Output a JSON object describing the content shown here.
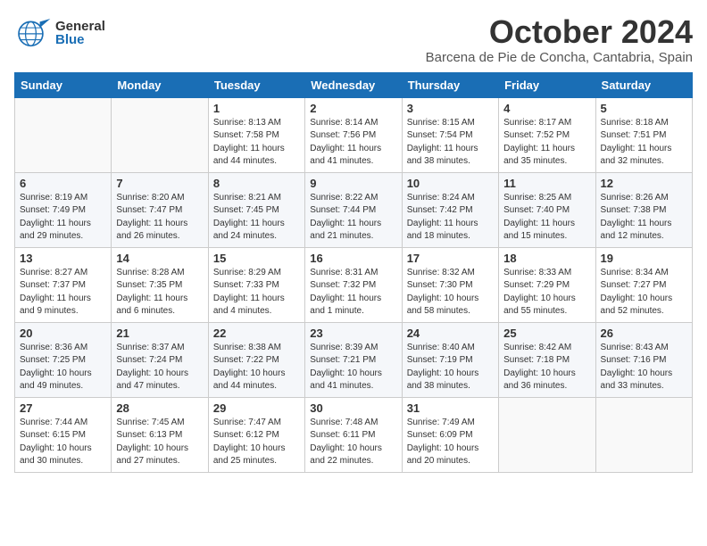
{
  "header": {
    "logo_general": "General",
    "logo_blue": "Blue",
    "month_title": "October 2024",
    "location": "Barcena de Pie de Concha, Cantabria, Spain"
  },
  "days_of_week": [
    "Sunday",
    "Monday",
    "Tuesday",
    "Wednesday",
    "Thursday",
    "Friday",
    "Saturday"
  ],
  "weeks": [
    [
      {
        "day": "",
        "info": ""
      },
      {
        "day": "",
        "info": ""
      },
      {
        "day": "1",
        "info": "Sunrise: 8:13 AM\nSunset: 7:58 PM\nDaylight: 11 hours and 44 minutes."
      },
      {
        "day": "2",
        "info": "Sunrise: 8:14 AM\nSunset: 7:56 PM\nDaylight: 11 hours and 41 minutes."
      },
      {
        "day": "3",
        "info": "Sunrise: 8:15 AM\nSunset: 7:54 PM\nDaylight: 11 hours and 38 minutes."
      },
      {
        "day": "4",
        "info": "Sunrise: 8:17 AM\nSunset: 7:52 PM\nDaylight: 11 hours and 35 minutes."
      },
      {
        "day": "5",
        "info": "Sunrise: 8:18 AM\nSunset: 7:51 PM\nDaylight: 11 hours and 32 minutes."
      }
    ],
    [
      {
        "day": "6",
        "info": "Sunrise: 8:19 AM\nSunset: 7:49 PM\nDaylight: 11 hours and 29 minutes."
      },
      {
        "day": "7",
        "info": "Sunrise: 8:20 AM\nSunset: 7:47 PM\nDaylight: 11 hours and 26 minutes."
      },
      {
        "day": "8",
        "info": "Sunrise: 8:21 AM\nSunset: 7:45 PM\nDaylight: 11 hours and 24 minutes."
      },
      {
        "day": "9",
        "info": "Sunrise: 8:22 AM\nSunset: 7:44 PM\nDaylight: 11 hours and 21 minutes."
      },
      {
        "day": "10",
        "info": "Sunrise: 8:24 AM\nSunset: 7:42 PM\nDaylight: 11 hours and 18 minutes."
      },
      {
        "day": "11",
        "info": "Sunrise: 8:25 AM\nSunset: 7:40 PM\nDaylight: 11 hours and 15 minutes."
      },
      {
        "day": "12",
        "info": "Sunrise: 8:26 AM\nSunset: 7:38 PM\nDaylight: 11 hours and 12 minutes."
      }
    ],
    [
      {
        "day": "13",
        "info": "Sunrise: 8:27 AM\nSunset: 7:37 PM\nDaylight: 11 hours and 9 minutes."
      },
      {
        "day": "14",
        "info": "Sunrise: 8:28 AM\nSunset: 7:35 PM\nDaylight: 11 hours and 6 minutes."
      },
      {
        "day": "15",
        "info": "Sunrise: 8:29 AM\nSunset: 7:33 PM\nDaylight: 11 hours and 4 minutes."
      },
      {
        "day": "16",
        "info": "Sunrise: 8:31 AM\nSunset: 7:32 PM\nDaylight: 11 hours and 1 minute."
      },
      {
        "day": "17",
        "info": "Sunrise: 8:32 AM\nSunset: 7:30 PM\nDaylight: 10 hours and 58 minutes."
      },
      {
        "day": "18",
        "info": "Sunrise: 8:33 AM\nSunset: 7:29 PM\nDaylight: 10 hours and 55 minutes."
      },
      {
        "day": "19",
        "info": "Sunrise: 8:34 AM\nSunset: 7:27 PM\nDaylight: 10 hours and 52 minutes."
      }
    ],
    [
      {
        "day": "20",
        "info": "Sunrise: 8:36 AM\nSunset: 7:25 PM\nDaylight: 10 hours and 49 minutes."
      },
      {
        "day": "21",
        "info": "Sunrise: 8:37 AM\nSunset: 7:24 PM\nDaylight: 10 hours and 47 minutes."
      },
      {
        "day": "22",
        "info": "Sunrise: 8:38 AM\nSunset: 7:22 PM\nDaylight: 10 hours and 44 minutes."
      },
      {
        "day": "23",
        "info": "Sunrise: 8:39 AM\nSunset: 7:21 PM\nDaylight: 10 hours and 41 minutes."
      },
      {
        "day": "24",
        "info": "Sunrise: 8:40 AM\nSunset: 7:19 PM\nDaylight: 10 hours and 38 minutes."
      },
      {
        "day": "25",
        "info": "Sunrise: 8:42 AM\nSunset: 7:18 PM\nDaylight: 10 hours and 36 minutes."
      },
      {
        "day": "26",
        "info": "Sunrise: 8:43 AM\nSunset: 7:16 PM\nDaylight: 10 hours and 33 minutes."
      }
    ],
    [
      {
        "day": "27",
        "info": "Sunrise: 7:44 AM\nSunset: 6:15 PM\nDaylight: 10 hours and 30 minutes."
      },
      {
        "day": "28",
        "info": "Sunrise: 7:45 AM\nSunset: 6:13 PM\nDaylight: 10 hours and 27 minutes."
      },
      {
        "day": "29",
        "info": "Sunrise: 7:47 AM\nSunset: 6:12 PM\nDaylight: 10 hours and 25 minutes."
      },
      {
        "day": "30",
        "info": "Sunrise: 7:48 AM\nSunset: 6:11 PM\nDaylight: 10 hours and 22 minutes."
      },
      {
        "day": "31",
        "info": "Sunrise: 7:49 AM\nSunset: 6:09 PM\nDaylight: 10 hours and 20 minutes."
      },
      {
        "day": "",
        "info": ""
      },
      {
        "day": "",
        "info": ""
      }
    ]
  ]
}
